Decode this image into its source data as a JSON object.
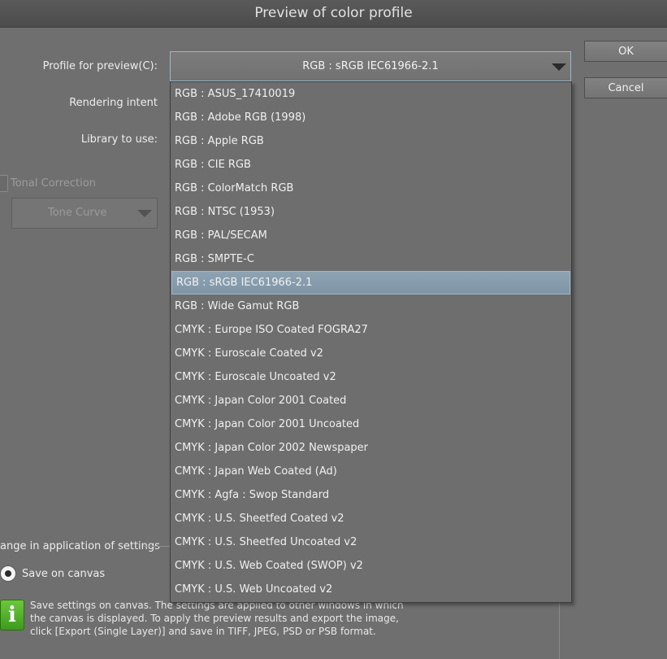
{
  "window": {
    "title": "Preview of color profile"
  },
  "buttons": {
    "ok": "OK",
    "cancel": "Cancel"
  },
  "labels": {
    "profile": "Profile for preview(C):",
    "rendering": "Rendering intent",
    "library": "Library to use:"
  },
  "profile_select": {
    "value": "RGB : sRGB IEC61966-2.1"
  },
  "tonal": {
    "label": "Tonal Correction",
    "tone_curve": "Tone Curve"
  },
  "settings_group": {
    "title": "ange in application of settings",
    "save_on_canvas": "Save on canvas",
    "info_lines": [
      "Save settings on canvas. The settings are applied to other windows in which",
      "the canvas is displayed. To apply the preview results and export the image,",
      "click [Export (Single Layer)] and save in TIFF, JPEG, PSD or PSB format."
    ]
  },
  "dropdown": {
    "options": [
      "RGB : ASUS_17410019",
      "RGB : Adobe RGB (1998)",
      "RGB : Apple RGB",
      "RGB : CIE RGB",
      "RGB : ColorMatch RGB",
      "RGB : NTSC (1953)",
      "RGB : PAL/SECAM",
      "RGB : SMPTE-C",
      "RGB : sRGB IEC61966-2.1",
      "RGB : Wide Gamut RGB",
      "CMYK : Europe ISO Coated FOGRA27",
      "CMYK : Euroscale Coated v2",
      "CMYK : Euroscale Uncoated v2",
      "CMYK : Japan Color 2001 Coated",
      "CMYK : Japan Color 2001 Uncoated",
      "CMYK : Japan Color 2002 Newspaper",
      "CMYK : Japan Web Coated (Ad)",
      "CMYK : Agfa : Swop Standard",
      "CMYK : U.S. Sheetfed Coated v2",
      "CMYK : U.S. Sheetfed Uncoated v2",
      "CMYK : U.S. Web Coated (SWOP) v2",
      "CMYK : U.S. Web Uncoated v2"
    ],
    "selected_index": 8
  },
  "icons": {
    "dropdown_arrow": "chevron-down-icon",
    "info": "info-icon"
  }
}
